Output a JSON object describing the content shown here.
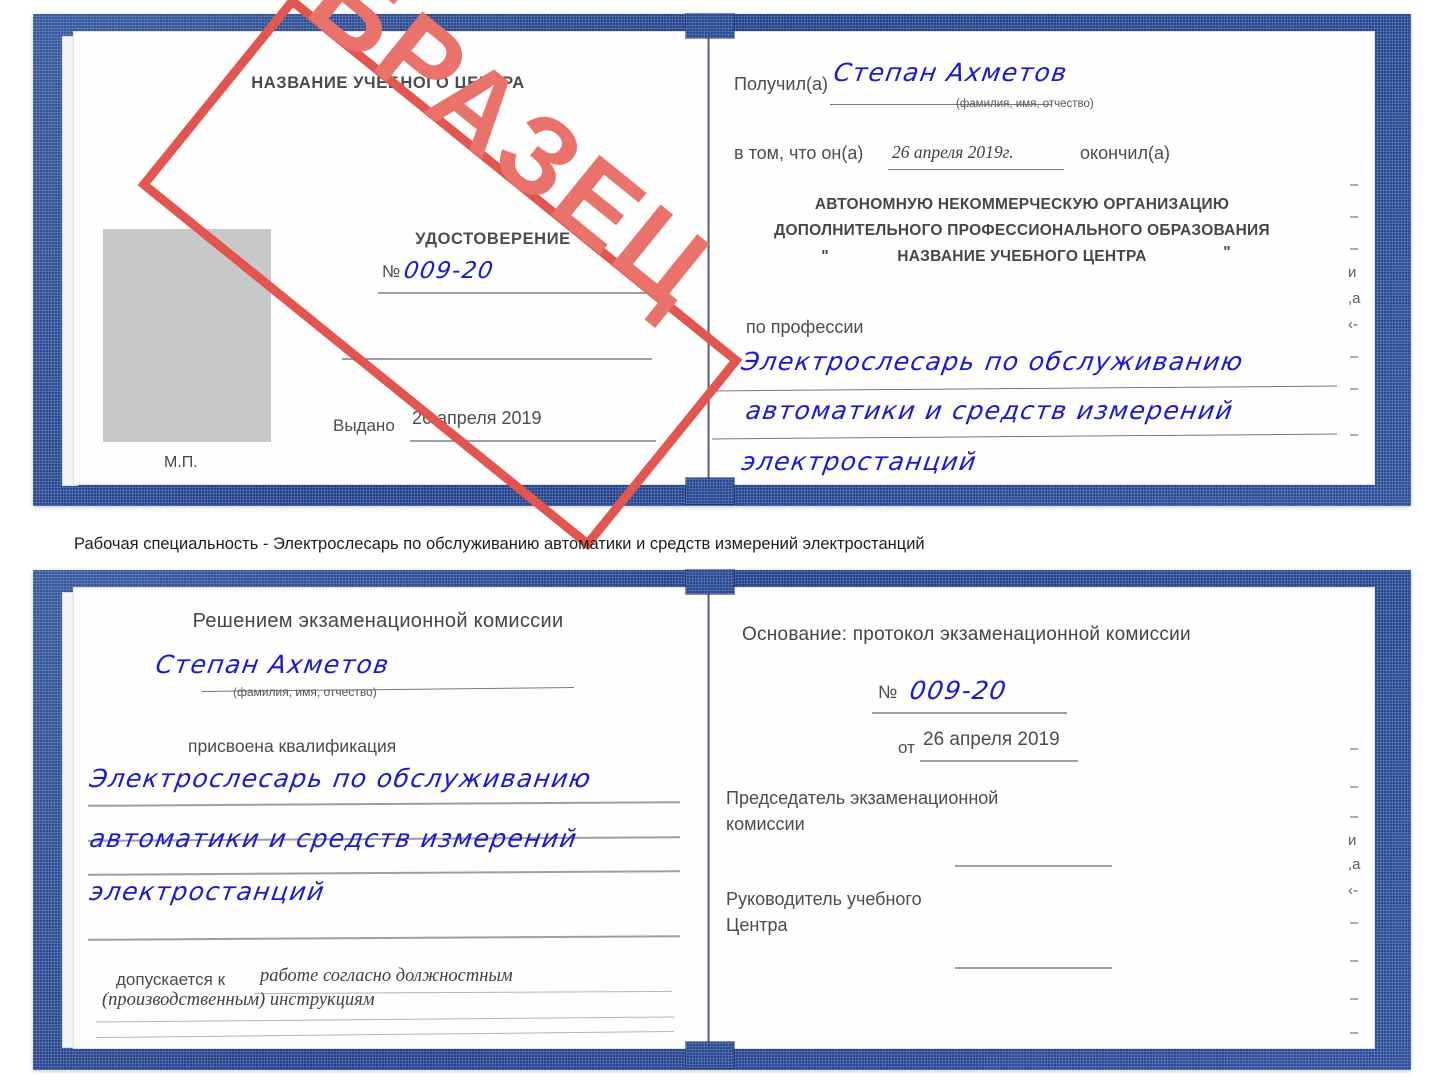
{
  "watermark": {
    "text": "ОБРАЗЕЦ",
    "color": "#e2564f",
    "text_color": "#e9726b"
  },
  "caption": {
    "text": "Рабочая специальность - Электрослесарь по обслуживанию автоматики и средств измерений электростанций"
  },
  "cover": {
    "color": "#2b4d96"
  },
  "cert_top": {
    "left_page": {
      "title": "НАЗВАНИЕ УЧЕБНОГО ЦЕНТРА",
      "doc_type": "УДОСТОВЕРЕНИЕ",
      "number_label": "№",
      "number_value": "009-20",
      "issued_label": "Выдано",
      "issued_value": "26 апреля 2019",
      "seal_label": "М.П."
    },
    "right_page": {
      "received_label": "Получил(а)",
      "received_value": "Степан Ахметов",
      "fio_hint": "(фамилия, имя, отчество)",
      "that_he_label": "в том, что он(а)",
      "finish_date": "26 апреля 2019г.",
      "finished_label": "окончил(а)",
      "org_line1": "АВТОНОМНУЮ НЕКОММЕРЧЕСКУЮ ОРГАНИЗАЦИЮ",
      "org_line2": "ДОПОЛНИТЕЛЬНОГО ПРОФЕССИОНАЛЬНОГО ОБРАЗОВАНИЯ",
      "org_quote_open": "\"",
      "org_line3": "НАЗВАНИЕ УЧЕБНОГО ЦЕНТРА",
      "org_quote_close": "\"",
      "profession_label": "по профессии",
      "profession_line1": "Электрослесарь по обслуживанию",
      "profession_line2": "автоматики и средств измерений",
      "profession_line3": "электростанций",
      "bleed_marks": [
        "–",
        "–",
        "–",
        "и",
        "̧а",
        "‹-",
        "–",
        "–",
        "–"
      ]
    }
  },
  "cert_bottom": {
    "left_page": {
      "title": "Решением экзаменационной комиссии",
      "name_value": "Степан Ахметов",
      "fio_hint": "(фамилия, имя, отчество)",
      "qualification_label": "присвоена квалификация",
      "qualification_line1": "Электрослесарь по обслуживанию",
      "qualification_line2": "автоматики и средств измерений",
      "qualification_line3": "электростанций",
      "allowed_label": "допускается к",
      "allowed_value1": "работе согласно должностным",
      "allowed_value2": "(производственным) инструкциям"
    },
    "right_page": {
      "basis_label": "Основание: протокол экзаменационной комиссии",
      "number_label": "№",
      "number_value": "009-20",
      "date_label": "от",
      "date_value": "26 апреля 2019",
      "chairman_line1": "Председатель экзаменационной",
      "chairman_line2": "комиссии",
      "head_line1": "Руководитель учебного",
      "head_line2": "Центра",
      "bleed_marks": [
        "–",
        "–",
        "и",
        "̧а",
        "‹-",
        "–",
        "–",
        "–",
        "–"
      ]
    }
  }
}
